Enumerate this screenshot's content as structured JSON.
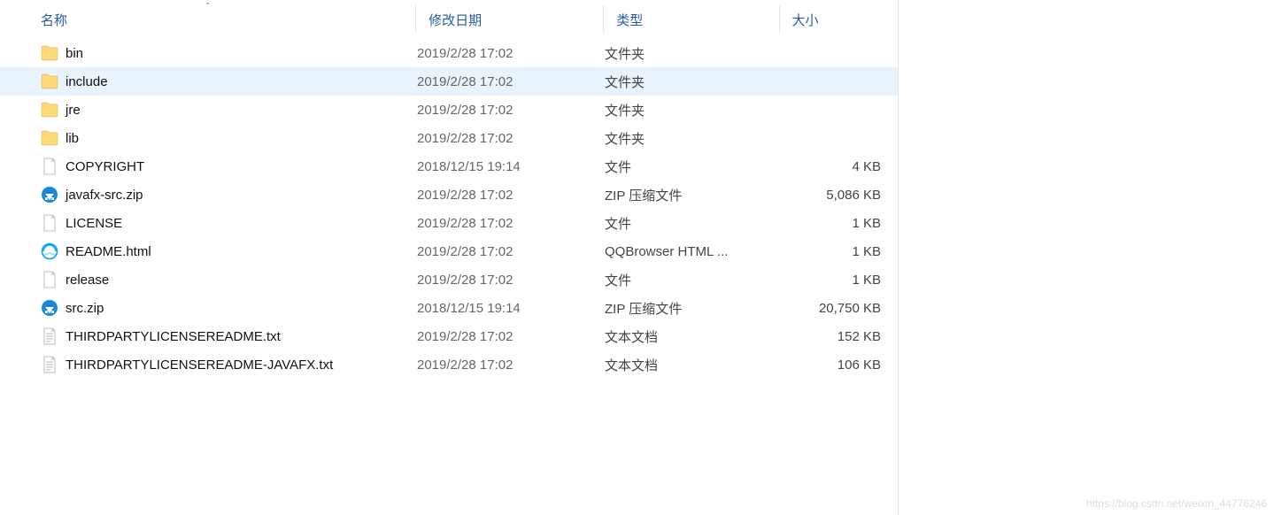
{
  "header": {
    "name": "名称",
    "date": "修改日期",
    "type": "类型",
    "size": "大小",
    "sort_indicator": "ˆ"
  },
  "rows": [
    {
      "icon": "folder",
      "name": "bin",
      "date": "2019/2/28 17:02",
      "type": "文件夹",
      "size": ""
    },
    {
      "icon": "folder",
      "name": "include",
      "date": "2019/2/28 17:02",
      "type": "文件夹",
      "size": "",
      "selected": true
    },
    {
      "icon": "folder",
      "name": "jre",
      "date": "2019/2/28 17:02",
      "type": "文件夹",
      "size": ""
    },
    {
      "icon": "folder",
      "name": "lib",
      "date": "2019/2/28 17:02",
      "type": "文件夹",
      "size": ""
    },
    {
      "icon": "file",
      "name": "COPYRIGHT",
      "date": "2018/12/15 19:14",
      "type": "文件",
      "size": "4 KB"
    },
    {
      "icon": "zip",
      "name": "javafx-src.zip",
      "date": "2019/2/28 17:02",
      "type": "ZIP 压缩文件",
      "size": "5,086 KB"
    },
    {
      "icon": "file",
      "name": "LICENSE",
      "date": "2019/2/28 17:02",
      "type": "文件",
      "size": "1 KB"
    },
    {
      "icon": "html",
      "name": "README.html",
      "date": "2019/2/28 17:02",
      "type": "QQBrowser HTML ...",
      "size": "1 KB"
    },
    {
      "icon": "file",
      "name": "release",
      "date": "2019/2/28 17:02",
      "type": "文件",
      "size": "1 KB"
    },
    {
      "icon": "zip",
      "name": "src.zip",
      "date": "2018/12/15 19:14",
      "type": "ZIP 压缩文件",
      "size": "20,750 KB"
    },
    {
      "icon": "txt",
      "name": "THIRDPARTYLICENSEREADME.txt",
      "date": "2019/2/28 17:02",
      "type": "文本文档",
      "size": "152 KB"
    },
    {
      "icon": "txt",
      "name": "THIRDPARTYLICENSEREADME-JAVAFX.txt",
      "date": "2019/2/28 17:02",
      "type": "文本文档",
      "size": "106 KB"
    }
  ],
  "watermark": "https://blog.csdn.net/weixin_44776246"
}
